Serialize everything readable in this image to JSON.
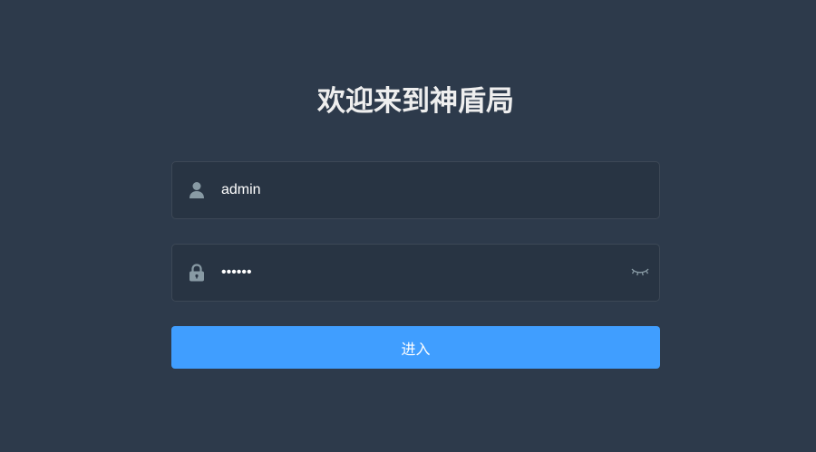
{
  "login": {
    "title": "欢迎来到神盾局",
    "username": {
      "value": "admin",
      "icon": "user-icon"
    },
    "password": {
      "value": "••••••",
      "icon": "lock-icon",
      "toggle_icon": "eye-closed-icon"
    },
    "submit_label": "进入"
  },
  "colors": {
    "background": "#2d3a4b",
    "input_background": "#283443",
    "icon": "#889aa4",
    "button": "#409eff",
    "title": "#eeeeee"
  }
}
